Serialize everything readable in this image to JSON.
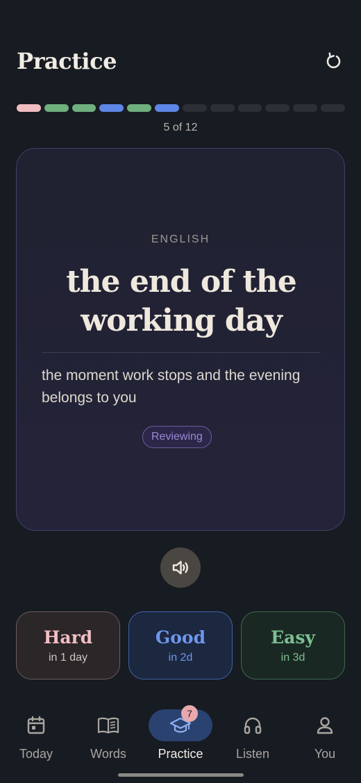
{
  "header": {
    "title": "Practice",
    "reset_icon": "refresh-icon"
  },
  "progress": {
    "current": 5,
    "total": 12,
    "label": "5 of 12",
    "segments": [
      "hard",
      "easy",
      "easy",
      "good",
      "easy",
      "good",
      "todo",
      "todo",
      "todo",
      "todo",
      "todo",
      "todo"
    ]
  },
  "colors": {
    "hard": "#f0bcc0",
    "easy": "#6fb07e",
    "good": "#5d86e6",
    "todo": "#2c3036",
    "accent": "#2a4270"
  },
  "card": {
    "language": "ENGLISH",
    "term": "the end of the working day",
    "definition": "the moment work stops and the evening belongs to you",
    "status": "Reviewing",
    "audio_icon": "speaker-icon"
  },
  "answers": [
    {
      "title": "Hard",
      "interval": "in 1 day"
    },
    {
      "title": "Good",
      "interval": "in 2d"
    },
    {
      "title": "Easy",
      "interval": "in 3d"
    }
  ],
  "nav": {
    "items": [
      {
        "label": "Today",
        "icon": "calendar-icon"
      },
      {
        "label": "Words",
        "icon": "book-icon"
      },
      {
        "label": "Practice",
        "icon": "graduation-cap-icon",
        "badge": "7",
        "active": true
      },
      {
        "label": "Listen",
        "icon": "headphones-icon"
      },
      {
        "label": "You",
        "icon": "person-icon"
      }
    ]
  }
}
